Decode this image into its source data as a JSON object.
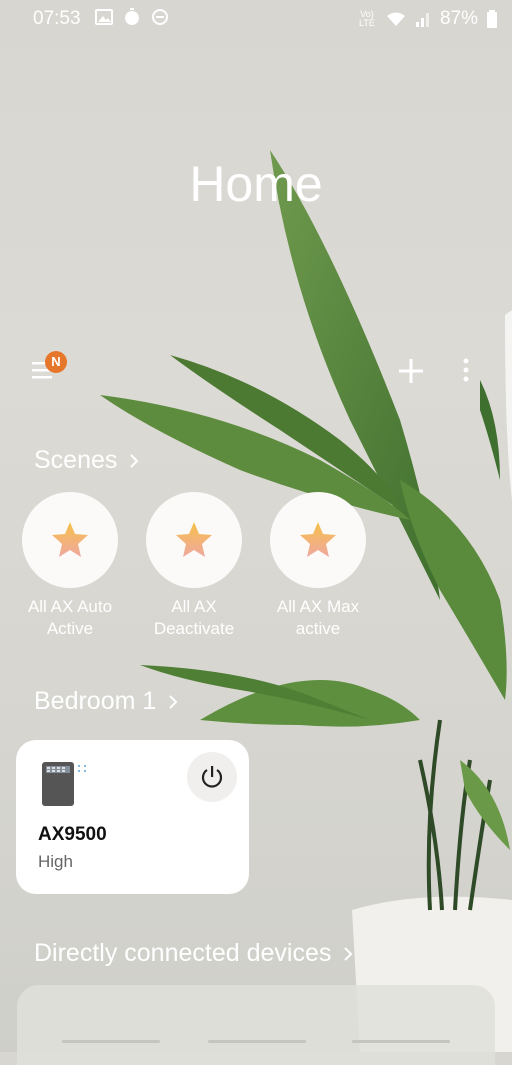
{
  "status_bar": {
    "time": "07:53",
    "lte_label": "Vo) LTE",
    "battery": "87%"
  },
  "header": {
    "title": "Home",
    "menu_badge": "N"
  },
  "scenes": {
    "title": "Scenes",
    "items": [
      {
        "label": "All AX Auto Active"
      },
      {
        "label": "All AX Deactivate"
      },
      {
        "label": "All AX Max active"
      }
    ]
  },
  "room": {
    "title": "Bedroom 1",
    "device": {
      "name": "AX9500",
      "status": "High"
    }
  },
  "direct": {
    "title": "Directly connected devices"
  },
  "colors": {
    "badge": "#e6772a",
    "star_top": "#f6c04a",
    "star_bottom": "#f0a8a0"
  }
}
